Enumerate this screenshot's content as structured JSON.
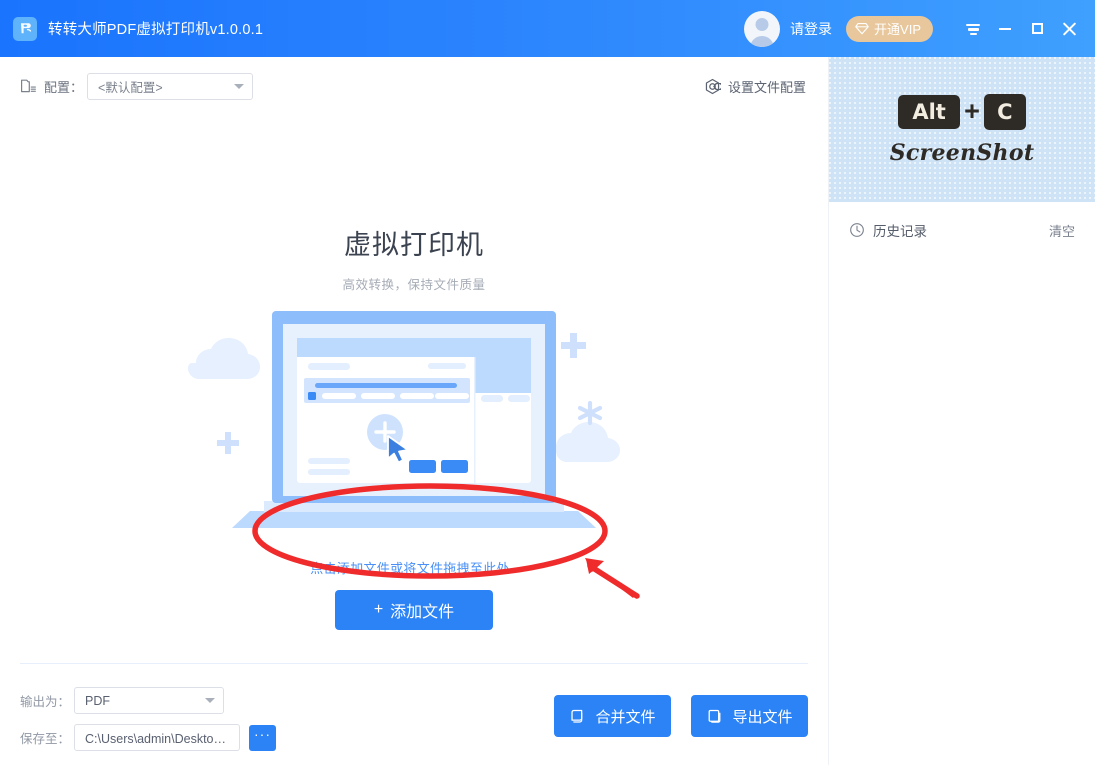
{
  "window": {
    "title": "转转大师PDF虚拟打印机v1.0.0.1",
    "app_icon": "printer-icon",
    "accent_color": "#2b83f6",
    "titlebar_gradient_start": "#1a74fd",
    "titlebar_gradient_end": "#3fa0fe",
    "login_label": "请登录",
    "vip_label": "开通VIP",
    "vip_color": "#e7c79b",
    "controls": {
      "menu": "menu-icon",
      "minimize": "minimize-icon",
      "maximize": "maximize-icon",
      "close": "close-icon"
    }
  },
  "config_bar": {
    "icon": "file-config-icon",
    "label": "配置：",
    "selected": "<默认配置>",
    "settings_icon": "gear-icon",
    "settings_label": "设置文件配置"
  },
  "hero": {
    "title": "虚拟打印机",
    "subtitle": "高效转换，保持文件质量",
    "illustration": "laptop-upload-illustration",
    "drop_hint": "点击添加文件或将文件拖拽至此处~",
    "add_button_plus": "+",
    "add_button_label": "添加文件"
  },
  "bottom": {
    "output_label": "输出为：",
    "output_value": "PDF",
    "save_label": "保存至：",
    "save_value": "C:\\Users\\admin\\Desktop\\转...",
    "browse_label": "···",
    "merge_label": "合并文件",
    "merge_icon": "copy-icon",
    "export_label": "导出文件",
    "export_icon": "document-icon"
  },
  "sidebar": {
    "ad": {
      "key1": "Alt",
      "plus": "+",
      "key2": "C",
      "caption": "ScreenShot"
    },
    "history": {
      "icon": "clock-icon",
      "title": "历史记录",
      "clear_label": "清空",
      "items": []
    }
  },
  "annotation": {
    "ellipse": "red-highlight-ellipse",
    "arrow": "red-pointer-arrow",
    "color": "#ef2b2b"
  }
}
